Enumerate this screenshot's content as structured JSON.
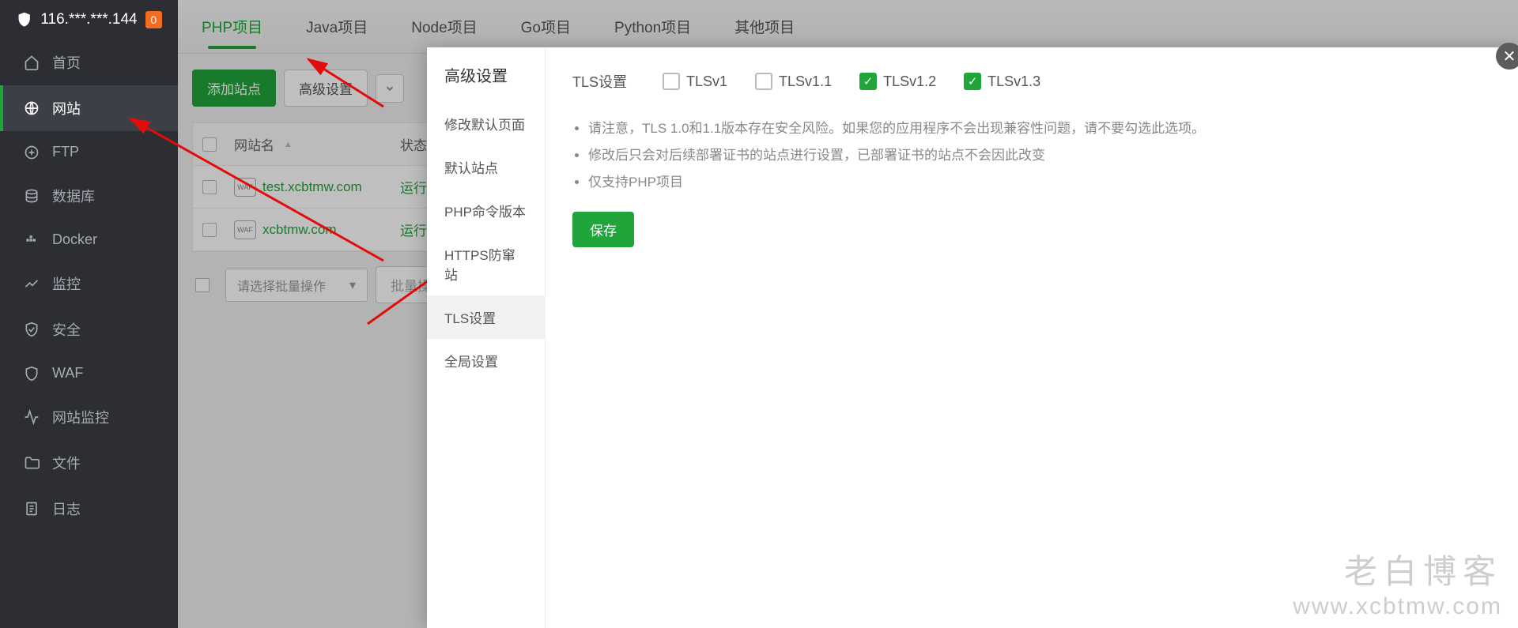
{
  "header": {
    "ip": "116.***.***.144",
    "badge": "0"
  },
  "sidebar": {
    "items": [
      {
        "label": "首页",
        "icon": "home"
      },
      {
        "label": "网站",
        "icon": "globe",
        "active": true
      },
      {
        "label": "FTP",
        "icon": "ftp"
      },
      {
        "label": "数据库",
        "icon": "db"
      },
      {
        "label": "Docker",
        "icon": "docker"
      },
      {
        "label": "监控",
        "icon": "monitor"
      },
      {
        "label": "安全",
        "icon": "security"
      },
      {
        "label": "WAF",
        "icon": "waf"
      },
      {
        "label": "网站监控",
        "icon": "sitemon"
      },
      {
        "label": "文件",
        "icon": "folder"
      },
      {
        "label": "日志",
        "icon": "log"
      }
    ]
  },
  "tabs": [
    "PHP项目",
    "Java项目",
    "Node项目",
    "Go项目",
    "Python项目",
    "其他项目"
  ],
  "activeTab": 0,
  "toolbar": {
    "add": "添加站点",
    "adv": "高级设置"
  },
  "table": {
    "headers": {
      "name": "网站名",
      "status": "状态"
    },
    "rows": [
      {
        "name": "test.xcbtmw.com",
        "status": "运行中"
      },
      {
        "name": "xcbtmw.com",
        "status": "运行中"
      }
    ]
  },
  "batch": {
    "placeholder": "请选择批量操作",
    "btn": "批量操作"
  },
  "modal": {
    "title": "高级设置",
    "nav": [
      "修改默认页面",
      "默认站点",
      "PHP命令版本",
      "HTTPS防窜站",
      "TLS设置",
      "全局设置"
    ],
    "activeNav": 4,
    "tls": {
      "label": "TLS设置",
      "options": [
        {
          "label": "TLSv1",
          "checked": false
        },
        {
          "label": "TLSv1.1",
          "checked": false
        },
        {
          "label": "TLSv1.2",
          "checked": true
        },
        {
          "label": "TLSv1.3",
          "checked": true
        }
      ]
    },
    "notes": [
      "请注意，TLS 1.0和1.1版本存在安全风险。如果您的应用程序不会出现兼容性问题，请不要勾选此选项。",
      "修改后只会对后续部署证书的站点进行设置，已部署证书的站点不会因此改变",
      "仅支持PHP项目"
    ],
    "save": "保存"
  },
  "watermark": {
    "l1": "老白博客",
    "l2": "www.xcbtmw.com"
  }
}
